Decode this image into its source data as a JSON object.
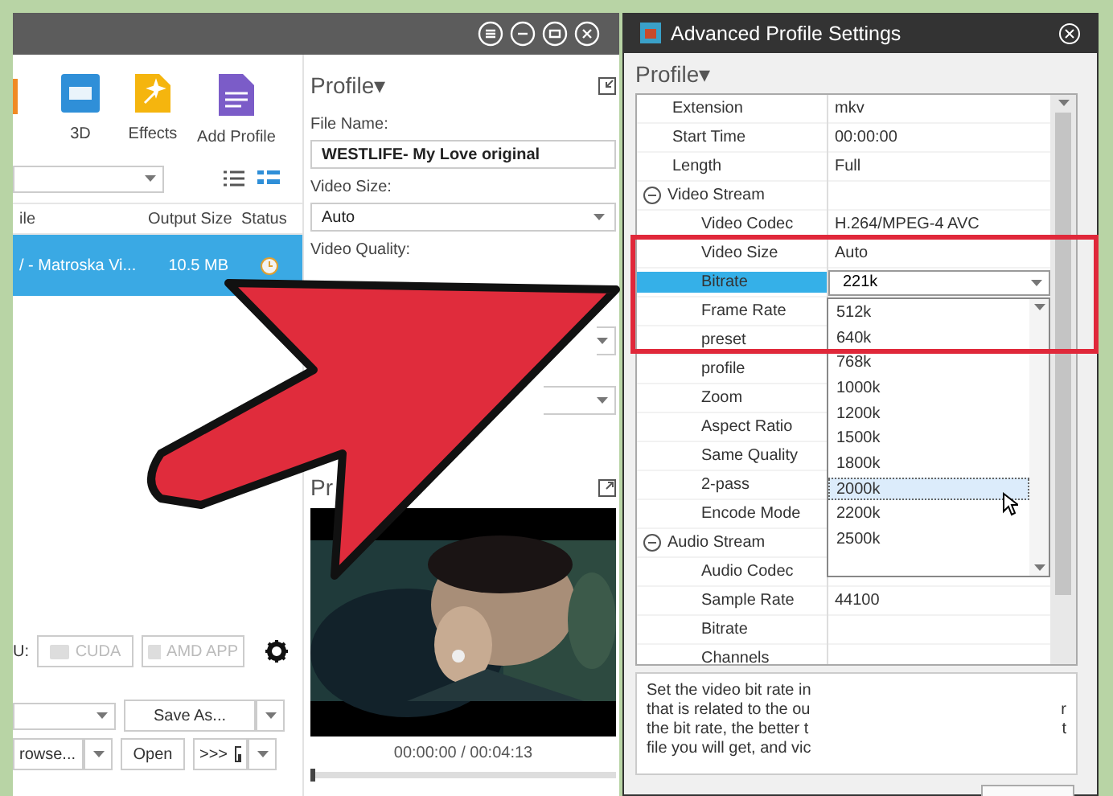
{
  "left_window": {
    "toolbar": [
      {
        "label": "3D",
        "kind": "cube"
      },
      {
        "label": "Effects",
        "kind": "wand"
      },
      {
        "label": "Add Profile",
        "kind": "document"
      }
    ],
    "file_list": {
      "columns": [
        "ile",
        "Output Size",
        "Status"
      ],
      "rows": [
        {
          "name": "/ - Matroska Vi...",
          "size": "10.5 MB",
          "selected": true
        }
      ]
    },
    "gpu": {
      "label": "U:",
      "buttons": [
        {
          "label": "CUDA",
          "disabled": true
        },
        {
          "label": "AMD APP",
          "disabled": true
        }
      ]
    },
    "save_as": "Save As...",
    "browse": "rowse...",
    "open": "Open",
    "open_folder": ">>>",
    "profile_panel": {
      "title": "Profile▾",
      "file_name_label": "File Name:",
      "file_name": "WESTLIFE- My Love original",
      "video_size_label": "Video Size:",
      "video_size": "Auto",
      "video_quality_label": "Video Quality:"
    },
    "preview": {
      "title": "Pr",
      "time": "00:00:00 / 00:04:13",
      "level": 0
    }
  },
  "dialog": {
    "title": "Advanced Profile Settings",
    "profile": "Profile▾",
    "properties": [
      {
        "name": "Extension",
        "value": "mkv",
        "selected": false
      },
      {
        "name": "Start Time",
        "value": "00:00:00",
        "selected": false
      },
      {
        "name": "Length",
        "value": "Full",
        "selected": false
      },
      {
        "name": "Video Stream",
        "selected": false,
        "expanded": true,
        "children": [
          {
            "name": "Video Codec",
            "value": "H.264/MPEG-4 AVC",
            "selected": false
          },
          {
            "name": "Video Size",
            "value": "Auto",
            "selected": false
          },
          {
            "name": "Bitrate",
            "value": "221k",
            "selected": true,
            "kind": "dropdown",
            "options": [
              {
                "label": "512k",
                "selected": false
              },
              {
                "label": "640k",
                "selected": false
              },
              {
                "label": "768k",
                "selected": false
              },
              {
                "label": "1000k",
                "selected": false
              },
              {
                "label": "1200k",
                "selected": false
              },
              {
                "label": "1500k",
                "selected": false
              },
              {
                "label": "1800k",
                "selected": false
              },
              {
                "label": "2000k",
                "selected": true
              },
              {
                "label": "2200k",
                "selected": false
              },
              {
                "label": "2500k",
                "selected": false
              }
            ]
          },
          {
            "name": "Frame Rate",
            "selected": false
          },
          {
            "name": "preset",
            "selected": false
          },
          {
            "name": "profile",
            "selected": false
          },
          {
            "name": "Zoom",
            "selected": false
          },
          {
            "name": "Aspect Ratio",
            "selected": false
          },
          {
            "name": "Same Quality",
            "selected": false
          },
          {
            "name": "2-pass",
            "selected": false
          },
          {
            "name": "Encode Mode",
            "selected": false
          }
        ]
      },
      {
        "name": "Audio Stream",
        "selected": false,
        "expanded": true,
        "children": [
          {
            "name": "Audio Codec",
            "selected": false
          },
          {
            "name": "Sample Rate",
            "value": "44100",
            "selected": false
          },
          {
            "name": "Bitrate",
            "selected": false
          },
          {
            "name": "Channels",
            "selected": false
          }
        ]
      }
    ],
    "description": [
      {
        "left": "Set the video bit rate in"
      },
      {
        "left": "that is related to the ou",
        "right": "r"
      },
      {
        "left": "the bit rate, the better t",
        "right": "t"
      },
      {
        "left": "file you will get, and vic"
      }
    ]
  }
}
